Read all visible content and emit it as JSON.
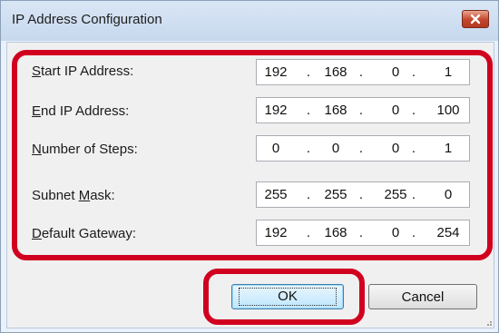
{
  "window": {
    "title": "IP Address Configuration"
  },
  "fields": [
    {
      "label_pre": "",
      "label_mnemonic": "S",
      "label_post": "tart IP Address:",
      "octets": [
        "192",
        "168",
        "0",
        "1"
      ]
    },
    {
      "label_pre": "",
      "label_mnemonic": "E",
      "label_post": "nd IP Address:",
      "octets": [
        "192",
        "168",
        "0",
        "100"
      ]
    },
    {
      "label_pre": "",
      "label_mnemonic": "N",
      "label_post": "umber of Steps:",
      "octets": [
        "0",
        "0",
        "0",
        "1"
      ]
    },
    {
      "label_pre": "Subnet ",
      "label_mnemonic": "M",
      "label_post": "ask:",
      "octets": [
        "255",
        "255",
        "255",
        "0"
      ]
    },
    {
      "label_pre": "",
      "label_mnemonic": "D",
      "label_post": "efault Gateway:",
      "octets": [
        "192",
        "168",
        "0",
        "254"
      ]
    }
  ],
  "separator": ".",
  "buttons": {
    "ok": "OK",
    "cancel": "Cancel"
  },
  "colors": {
    "highlight": "#d1001f",
    "close_button": "#c3452c"
  },
  "icons": {
    "close": "close-icon"
  }
}
